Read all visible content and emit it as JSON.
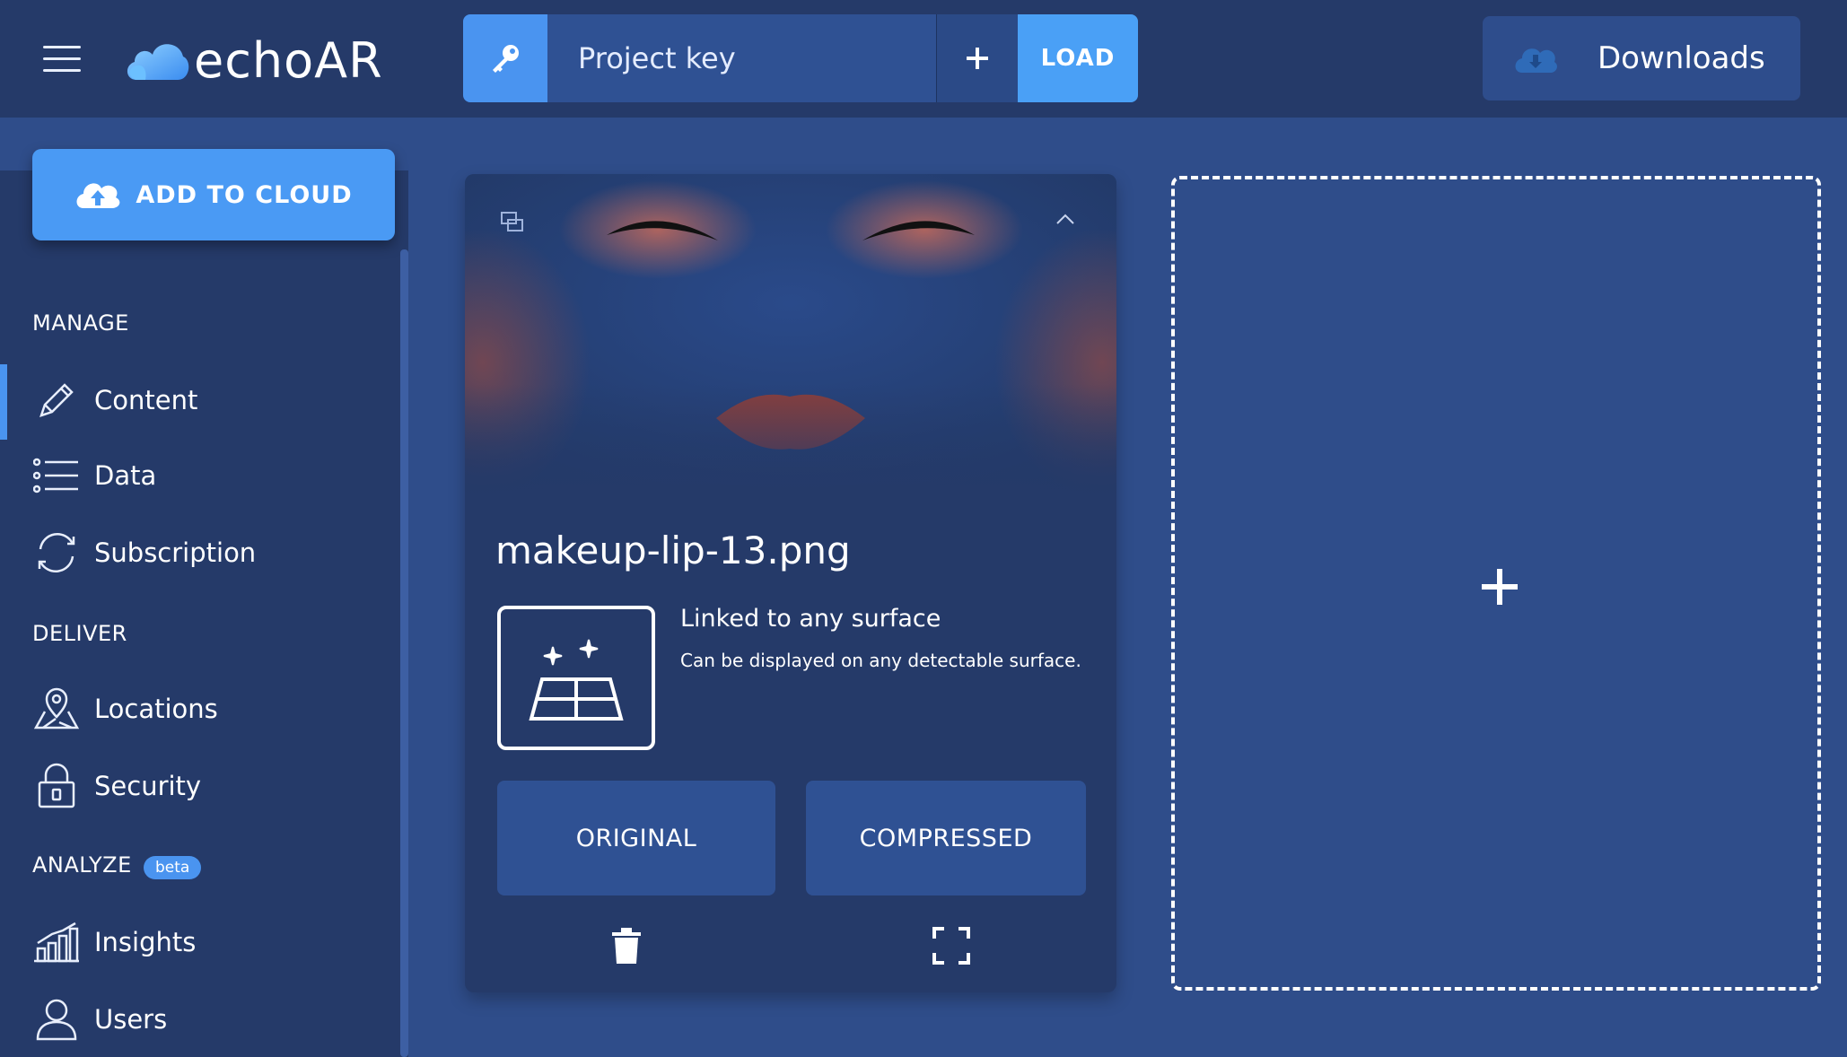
{
  "header": {
    "logo_text": "echoAR",
    "project_key_placeholder": "Project key",
    "load_label": "LOAD",
    "downloads_label": "Downloads"
  },
  "sidebar": {
    "add_to_cloud_label": "ADD TO CLOUD",
    "sections": {
      "manage": "MANAGE",
      "deliver": "DELIVER",
      "analyze": "ANALYZE"
    },
    "beta_label": "beta",
    "items": [
      {
        "label": "Content",
        "icon": "pencil-icon",
        "active": true
      },
      {
        "label": "Data",
        "icon": "list-icon"
      },
      {
        "label": "Subscription",
        "icon": "refresh-icon"
      },
      {
        "label": "Locations",
        "icon": "map-pin-icon"
      },
      {
        "label": "Security",
        "icon": "lock-icon"
      },
      {
        "label": "Insights",
        "icon": "bar-chart-icon"
      },
      {
        "label": "Users",
        "icon": "user-icon"
      }
    ]
  },
  "card": {
    "title": "makeup-lip-13.png",
    "surface_title": "Linked to any surface",
    "surface_desc": "Can be displayed on any detectable surface.",
    "original_label": "ORIGINAL",
    "compressed_label": "COMPRESSED"
  },
  "colors": {
    "header_bg": "#253a69",
    "page_bg": "#2f4d8a",
    "accent": "#4a94f0",
    "button_bg": "#2f5193"
  }
}
